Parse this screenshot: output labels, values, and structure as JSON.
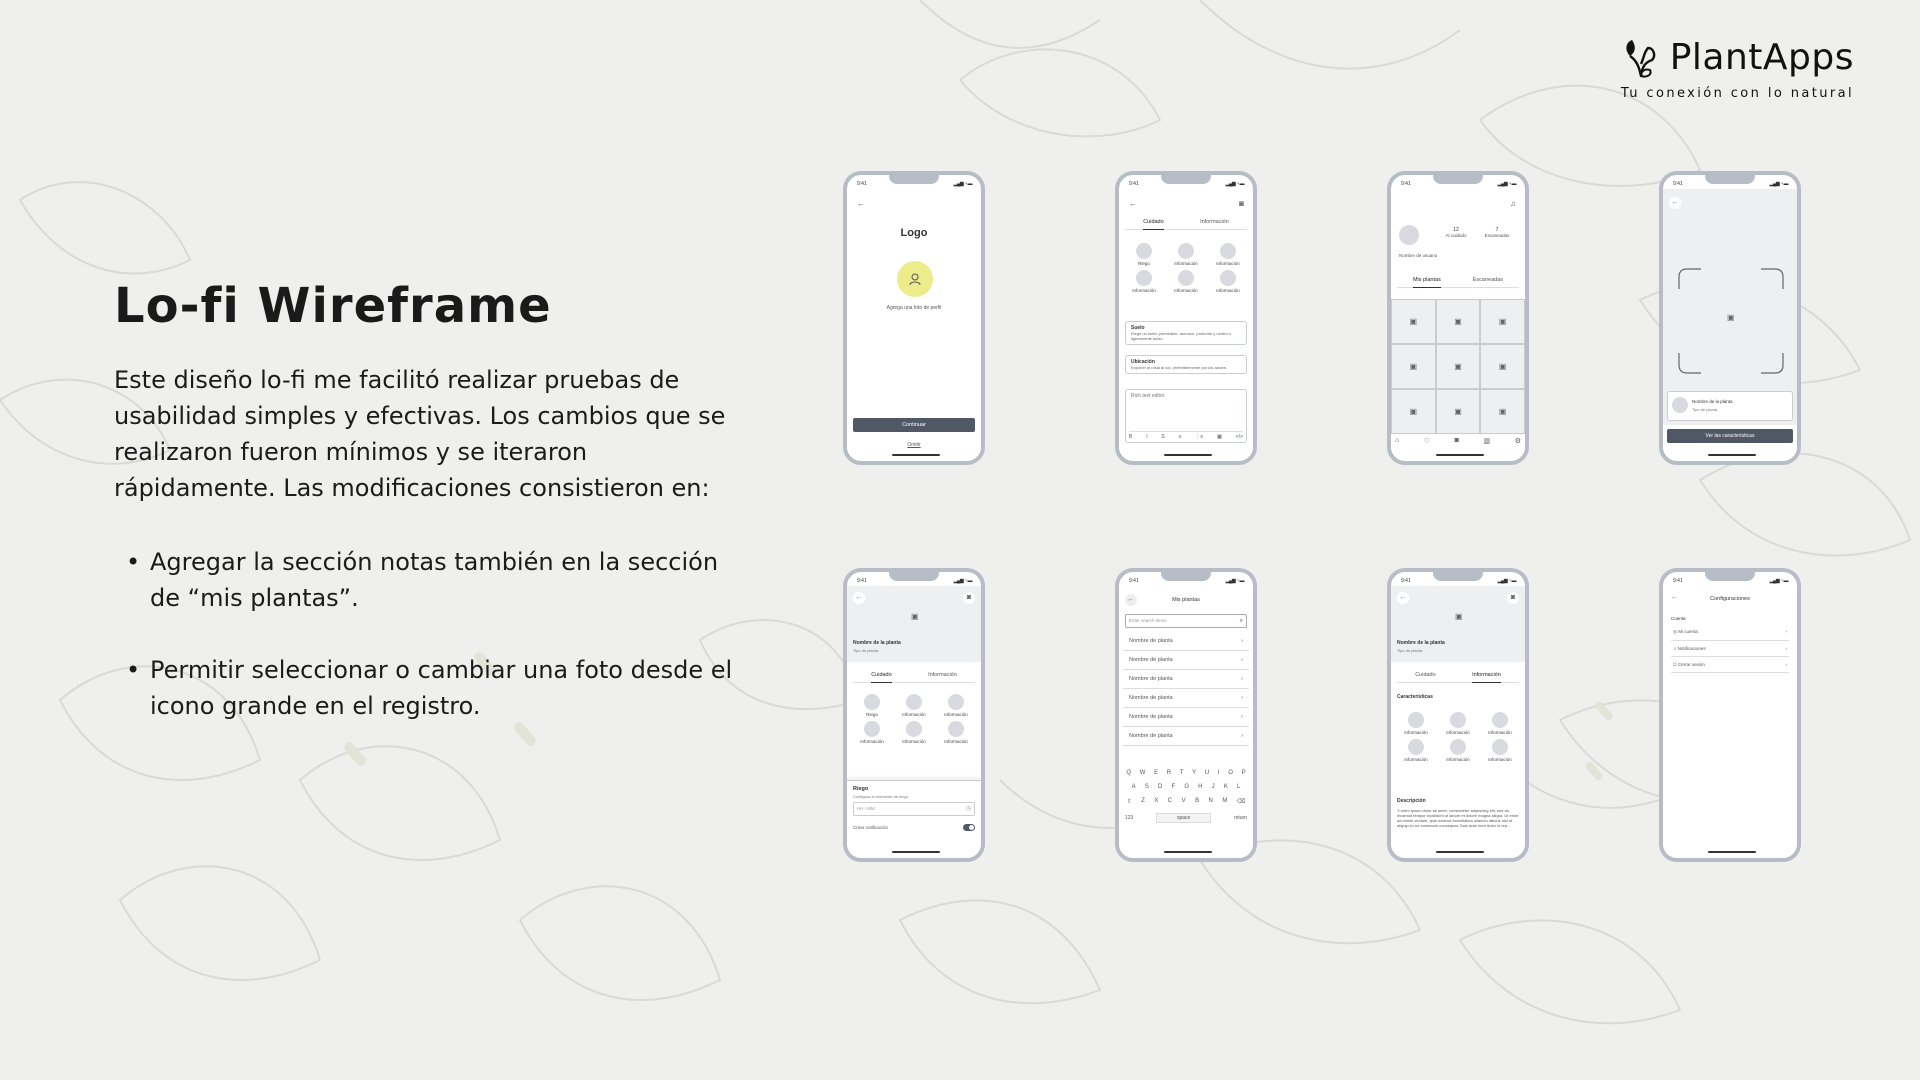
{
  "brand": {
    "name": "PlantApps",
    "tagline": "Tu conexión con lo natural"
  },
  "title": "Lo-fi Wireframe",
  "intro": "Este diseño lo-fi me facilitó realizar pruebas de usabilidad simples y efectivas. Los cambios que se realizaron fueron mínimos y se iteraron rápidamente. Las modificaciones consistieron en:",
  "bullets": [
    "Agregar la sección notas también en la sección de “mis plantas”.",
    "Permitir seleccionar o cambiar una foto desde el icono grande en el registro."
  ],
  "phones": {
    "status_time": "9:41",
    "p1": {
      "logo": "Logo",
      "add_photo": "Agrega una foto de perfil",
      "continue": "Continuar",
      "skip": "Omitir"
    },
    "p2": {
      "tabs": [
        "Cuidado",
        "Información"
      ],
      "items": [
        "Riego",
        "Información",
        "Información",
        "Información",
        "Información",
        "Información"
      ],
      "card1_title": "Suelo",
      "card1_text": "Elegir un suelo permeable, arenoso, profundo y neutro o ligeramente ácido.",
      "card2_title": "Ubicación",
      "card2_text": "Exponer al rosal al sol, preferiblemente por las tardes.",
      "editor_placeholder": "Rich text editor.",
      "toolbar": [
        "B",
        "I",
        "S",
        "≡",
        "⋮≡",
        "▦",
        "</>"
      ]
    },
    "p3": {
      "stat1_value": "12",
      "stat1_label": "Al cuidado",
      "stat2_value": "7",
      "stat2_label": "Escaneadas",
      "username": "Nombre de usuario",
      "tabs": [
        "Mis plantas",
        "Escaneadas"
      ]
    },
    "p4": {
      "plant_name": "Nombre de la planta",
      "plant_type": "Tipo de planta",
      "button": "Ver las características"
    },
    "p5": {
      "plant_name": "Nombre de la planta",
      "plant_type": "Tipo de planta",
      "tabs": [
        "Cuidado",
        "Información"
      ],
      "items": [
        "Riego",
        "Información",
        "Información",
        "Información",
        "Información",
        "Información"
      ],
      "section_title": "Riego",
      "section_sub": "Configura el momento de riego",
      "time_placeholder": "HH / MM",
      "notify": "Crear notificación"
    },
    "p6": {
      "title": "Mis plantas",
      "search_placeholder": "Enter search items",
      "rows": [
        "Nombre de planta",
        "Nombre de planta",
        "Nombre de planta",
        "Nombre de planta",
        "Nombre de planta",
        "Nombre de planta"
      ],
      "kb_row1": [
        "Q",
        "W",
        "E",
        "R",
        "T",
        "Y",
        "U",
        "I",
        "O",
        "P"
      ],
      "kb_row2": [
        "A",
        "S",
        "D",
        "F",
        "G",
        "H",
        "J",
        "K",
        "L"
      ],
      "kb_row3": [
        "Z",
        "X",
        "C",
        "V",
        "B",
        "N",
        "M"
      ],
      "kb_123": "123",
      "kb_space": "space",
      "kb_return": "return"
    },
    "p7": {
      "plant_name": "Nombre de la planta",
      "plant_type": "Tipo de planta",
      "tabs": [
        "Cuidado",
        "Información"
      ],
      "section1": "Características",
      "items": [
        "Información",
        "Información",
        "Información",
        "Información",
        "Información",
        "Información"
      ],
      "section2": "Descripción",
      "description": "\"Lorem ipsum dolor sit amet, consectetur adipiscing elit, sed do eiusmod tempor incididunt ut labore et dolore magna aliqua. Ut enim ad minim veniam, quis nostrud exercitation ullamco laboris nisi ut aliquip ex ea commodo consequat. Duis aute irure dolor in rep..."
    },
    "p8": {
      "title": "Configuraciones",
      "section": "Cuenta",
      "items": [
        "Mi cuenta",
        "Notificaciones",
        "Cerrar sesión"
      ]
    }
  },
  "colors": {
    "background": "#efefed",
    "phone_border": "#b7bcc6",
    "avatar_accent": "#ecec8a",
    "button_dark": "#505866"
  }
}
